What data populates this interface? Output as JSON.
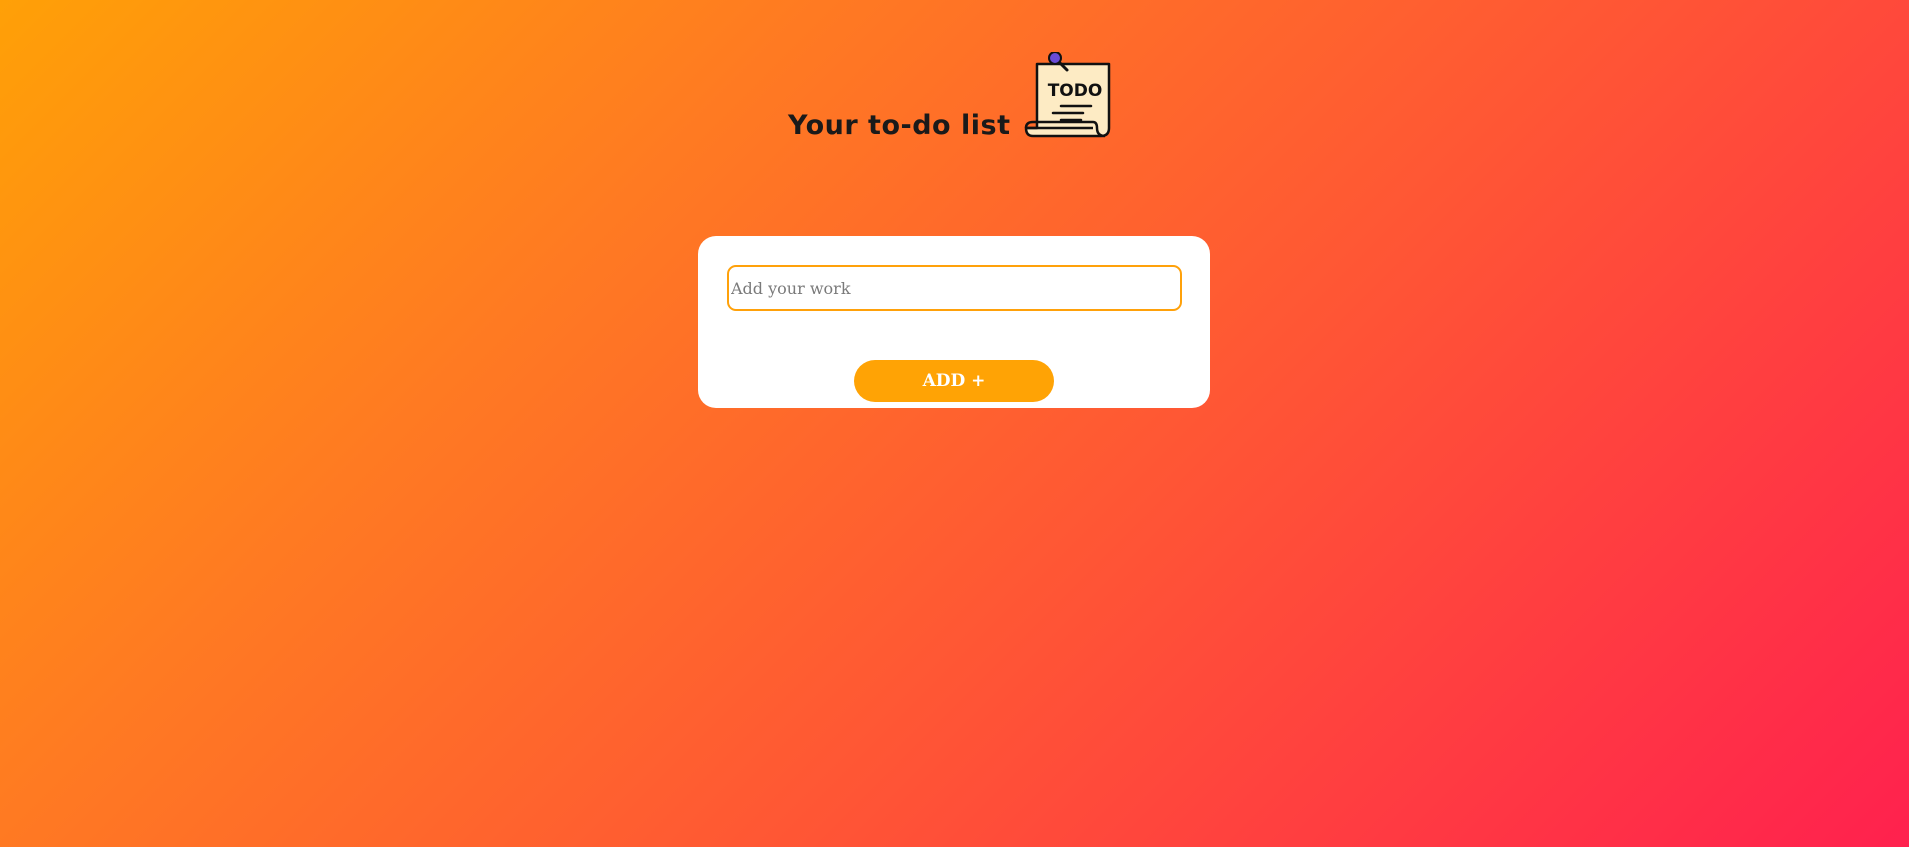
{
  "header": {
    "title": "Your to-do list",
    "icon": "todo-note-icon",
    "icon_text": "TODO"
  },
  "form": {
    "input_placeholder": "Add your work",
    "input_value": "",
    "add_label": "ADD +"
  },
  "colors": {
    "background_start": "#ffa007",
    "background_end": "#ff214e",
    "accent": "#ffa305",
    "card": "#ffffff"
  }
}
